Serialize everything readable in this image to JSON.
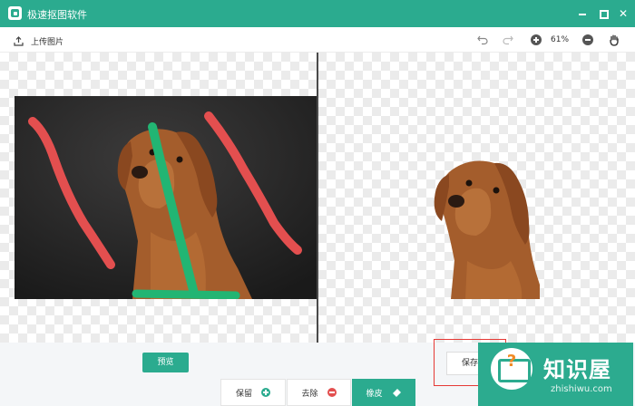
{
  "app": {
    "title": "极速抠图软件"
  },
  "window_controls": {
    "minimize": "minimize",
    "maximize": "maximize",
    "close": "✕"
  },
  "toolbar": {
    "upload_label": "上传图片",
    "zoom_level": "61%",
    "icons": [
      "upload-icon",
      "undo-icon",
      "redo-icon",
      "zoom-in-icon",
      "zoom-out-icon",
      "hand-icon"
    ]
  },
  "bottom": {
    "preview_label": "预览",
    "keep_label": "保留",
    "remove_label": "去除",
    "eraser_label": "橡皮",
    "save_label": "保存"
  },
  "watermark": {
    "title": "知识屋",
    "subtitle": "zhishiwu.com"
  },
  "colors": {
    "accent": "#2bab8f",
    "remove_stroke": "#e34f4f",
    "keep_stroke": "#22b573",
    "highlight_box": "#e53935"
  }
}
